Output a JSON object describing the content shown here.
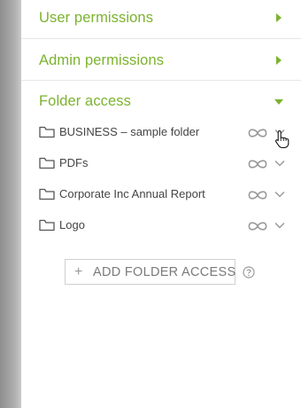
{
  "sections": {
    "user_permissions": {
      "label": "User permissions",
      "expanded": false
    },
    "admin_permissions": {
      "label": "Admin permissions",
      "expanded": false
    },
    "folder_access": {
      "label": "Folder access",
      "expanded": true
    }
  },
  "folders": [
    {
      "name": "BUSINESS – sample folder",
      "icon": "folder-icon",
      "access_icon": "infinity-link-icon",
      "menu_icon": "chevron-down-icon"
    },
    {
      "name": "PDFs",
      "icon": "folder-icon",
      "access_icon": "infinity-link-icon",
      "menu_icon": "chevron-down-icon"
    },
    {
      "name": "Corporate Inc Annual Report",
      "icon": "folder-icon",
      "access_icon": "infinity-link-icon",
      "menu_icon": "chevron-down-icon"
    },
    {
      "name": "Logo",
      "icon": "folder-icon",
      "access_icon": "infinity-link-icon",
      "menu_icon": "chevron-down-icon"
    }
  ],
  "add_folder_access": {
    "plus": "+",
    "label": "ADD FOLDER ACCESS"
  },
  "help_icon": "question-circle-icon",
  "cursor": "hand-pointer-icon",
  "colors": {
    "accent": "#7bb32e",
    "text": "#444444",
    "icon": "#9a9a9a",
    "border": "#cfcfcf"
  }
}
